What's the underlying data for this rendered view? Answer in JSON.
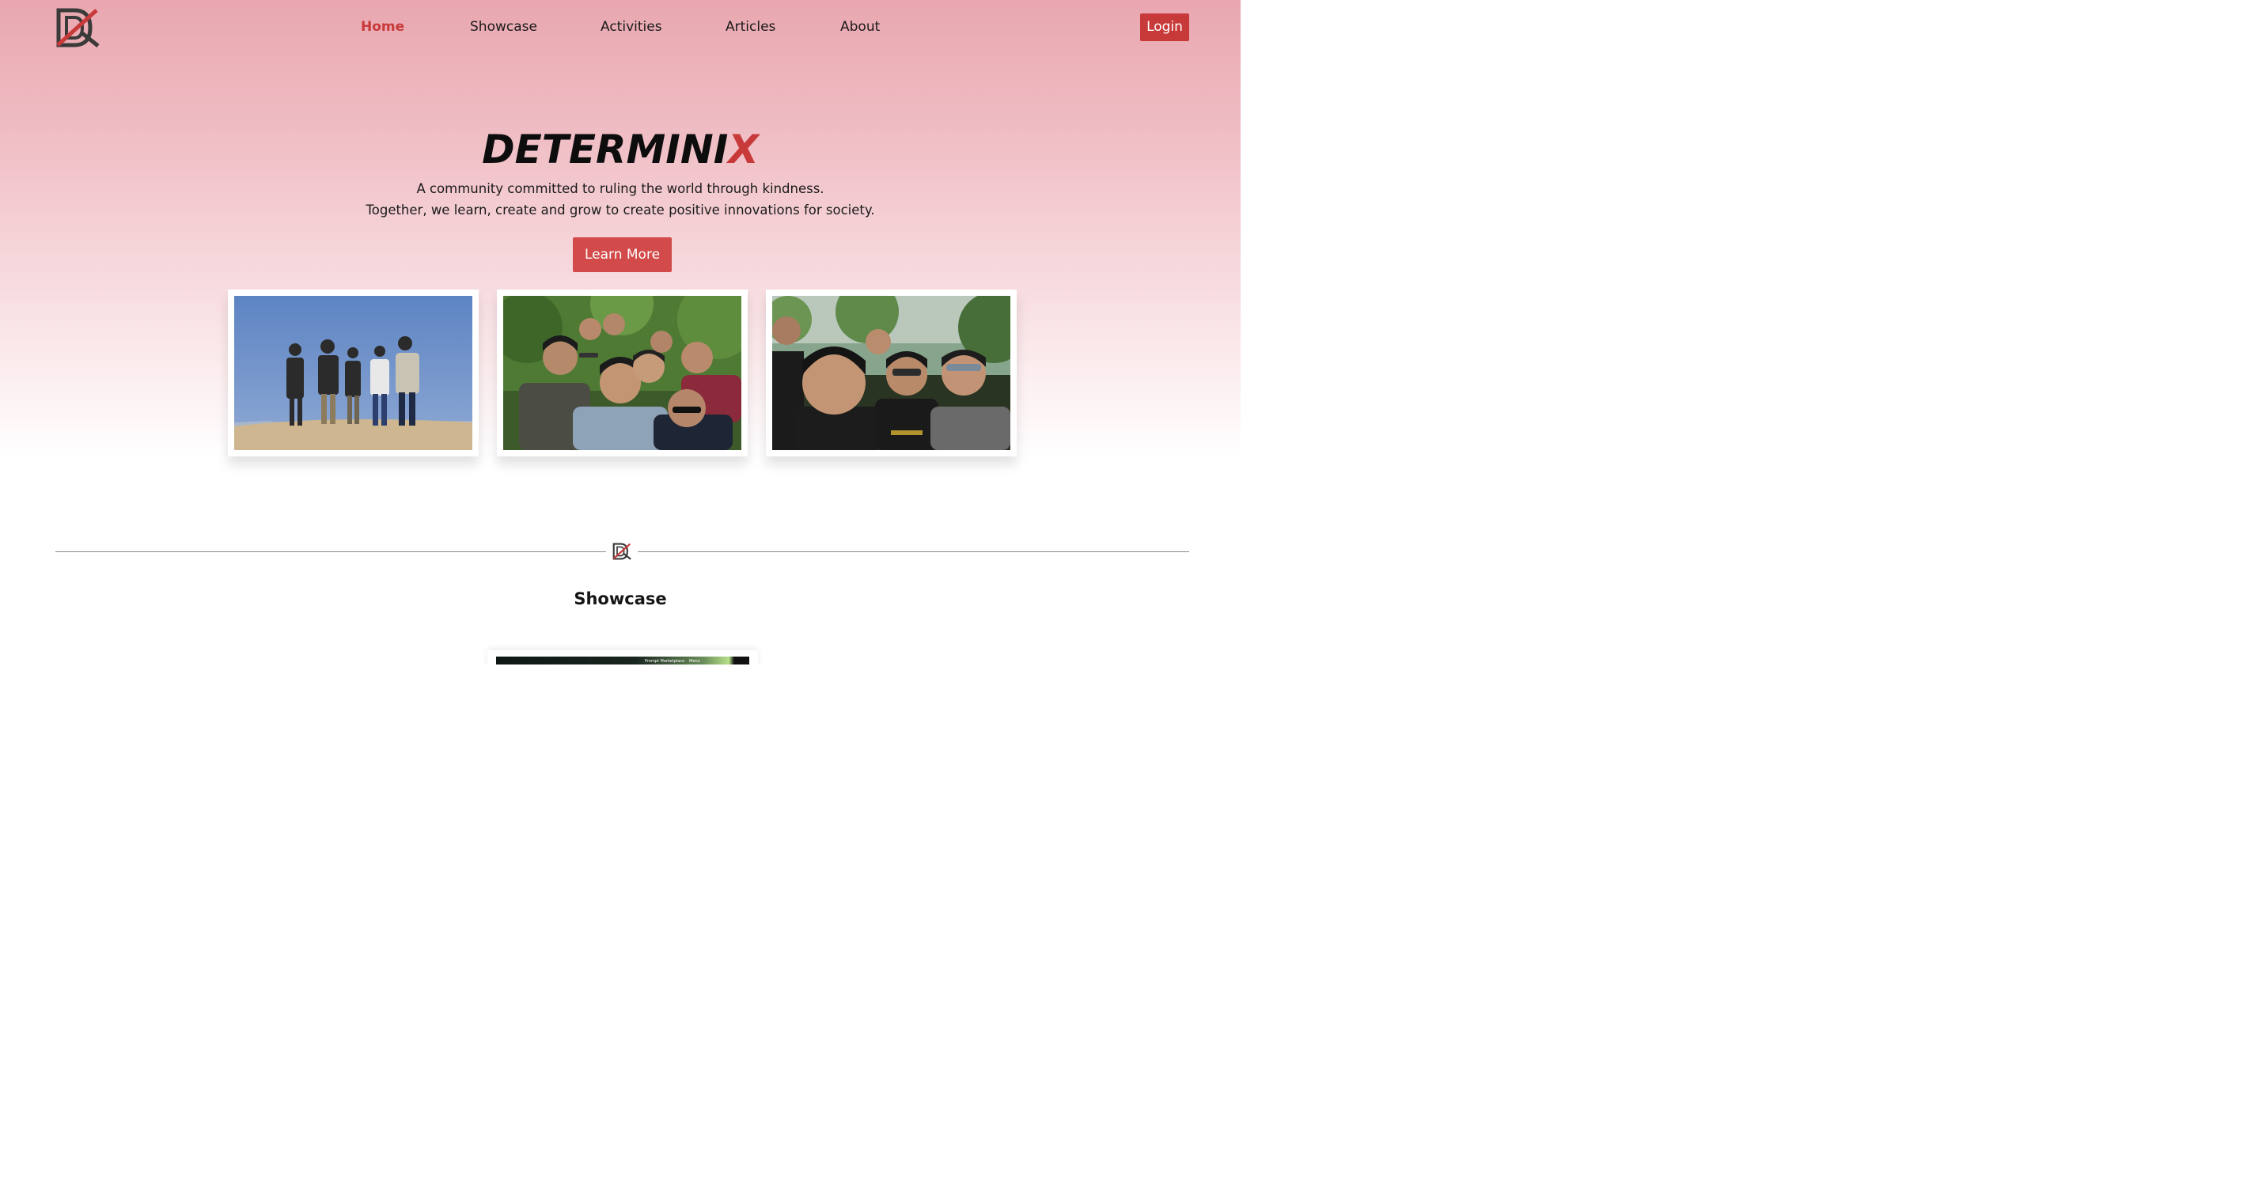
{
  "colors": {
    "accent": "#c8393a",
    "button": "#d24a4a",
    "header_pink": "#e9a7b0"
  },
  "header": {
    "logo_icon": "determinix-logo-icon",
    "nav": [
      {
        "label": "Home",
        "active": true
      },
      {
        "label": "Showcase",
        "active": false
      },
      {
        "label": "Activities",
        "active": false
      },
      {
        "label": "Articles",
        "active": false
      },
      {
        "label": "About",
        "active": false
      }
    ],
    "login_label": "Login"
  },
  "hero": {
    "title_main": "DETERMINI",
    "title_accent": "X",
    "tagline_line1": "A community committed to ruling the world through kindness.",
    "tagline_line2": "Together, we learn, create and grow to create positive innovations for society.",
    "cta_label": "Learn More"
  },
  "photos": [
    {
      "icon": "group-photo-mountain"
    },
    {
      "icon": "group-photo-selfie-garden"
    },
    {
      "icon": "group-photo-selfie-forest"
    }
  ],
  "divider": {
    "icon": "determinix-logo-icon"
  },
  "showcase": {
    "title": "Showcase",
    "thumb_text_1": "Prompt Marketplace",
    "thumb_text_2": "Menu"
  }
}
